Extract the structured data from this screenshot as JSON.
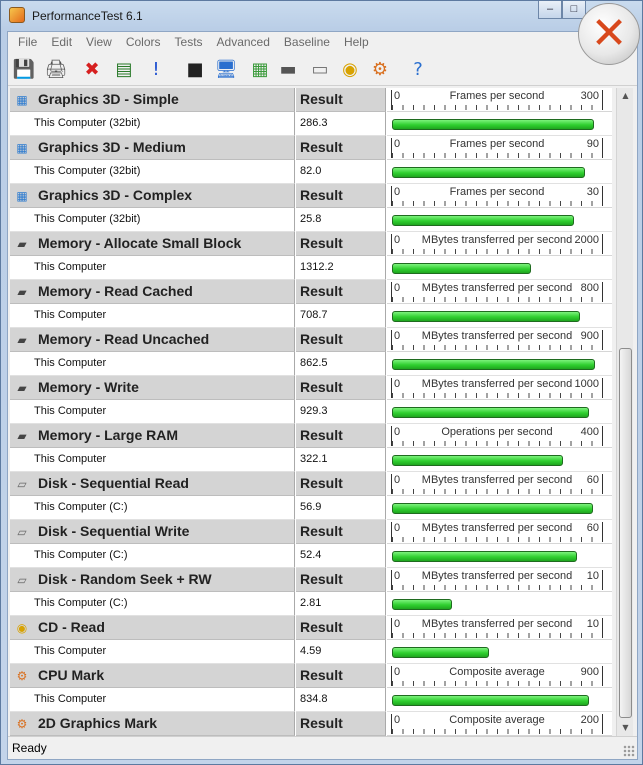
{
  "window": {
    "title": "PerformanceTest 6.1",
    "status": "Ready"
  },
  "menu": [
    "File",
    "Edit",
    "View",
    "Colors",
    "Tests",
    "Advanced",
    "Baseline",
    "Help"
  ],
  "toolbar": [
    {
      "name": "save-icon",
      "glyph": "💾"
    },
    {
      "name": "print-icon",
      "glyph": "🖨"
    },
    {
      "name": "delete-icon",
      "glyph": "✖"
    },
    {
      "name": "report-icon",
      "glyph": "▤"
    },
    {
      "name": "info-icon",
      "glyph": "!"
    },
    {
      "name": "stop-icon",
      "glyph": "■"
    },
    {
      "name": "monitor-icon",
      "glyph": "🖥"
    },
    {
      "name": "3d-cubes-icon",
      "glyph": "▦"
    },
    {
      "name": "memory-chip-icon",
      "glyph": "▬"
    },
    {
      "name": "disk-drive-icon",
      "glyph": "▭"
    },
    {
      "name": "cd-icon",
      "glyph": "◉"
    },
    {
      "name": "cpu-mark-icon",
      "glyph": "⚙"
    },
    {
      "name": "help-icon",
      "glyph": "?"
    }
  ],
  "result_label": "Result",
  "tests": [
    {
      "name": "Graphics 3D - Simple",
      "icon": "3d-cubes-icon",
      "computer": "This Computer (32bit)",
      "result": "286.3",
      "unit": "Frames per second",
      "min": "0",
      "max": "300",
      "value": 286.3,
      "scale_max": 300
    },
    {
      "name": "Graphics 3D - Medium",
      "icon": "3d-cubes-icon",
      "computer": "This Computer (32bit)",
      "result": "82.0",
      "unit": "Frames per second",
      "min": "0",
      "max": "90",
      "value": 82.0,
      "scale_max": 90
    },
    {
      "name": "Graphics 3D - Complex",
      "icon": "3d-cubes-icon",
      "computer": "This Computer (32bit)",
      "result": "25.8",
      "unit": "Frames per second",
      "min": "0",
      "max": "30",
      "value": 25.8,
      "scale_max": 30
    },
    {
      "name": "Memory - Allocate Small Block",
      "icon": "memory-chip-icon",
      "computer": "This Computer",
      "result": "1312.2",
      "unit": "MBytes transferred per second",
      "min": "0",
      "max": "2000",
      "value": 1312.2,
      "scale_max": 2000
    },
    {
      "name": "Memory - Read Cached",
      "icon": "memory-chip-icon",
      "computer": "This Computer",
      "result": "708.7",
      "unit": "MBytes transferred per second",
      "min": "0",
      "max": "800",
      "value": 708.7,
      "scale_max": 800
    },
    {
      "name": "Memory - Read Uncached",
      "icon": "memory-chip-icon",
      "computer": "This Computer",
      "result": "862.5",
      "unit": "MBytes transferred per second",
      "min": "0",
      "max": "900",
      "value": 862.5,
      "scale_max": 900
    },
    {
      "name": "Memory - Write",
      "icon": "memory-chip-icon",
      "computer": "This Computer",
      "result": "929.3",
      "unit": "MBytes transferred per second",
      "min": "0",
      "max": "1000",
      "value": 929.3,
      "scale_max": 1000
    },
    {
      "name": "Memory - Large RAM",
      "icon": "memory-chip-icon",
      "computer": "This Computer",
      "result": "322.1",
      "unit": "Operations per second",
      "min": "0",
      "max": "400",
      "value": 322.1,
      "scale_max": 400
    },
    {
      "name": "Disk - Sequential Read",
      "icon": "disk-drive-icon",
      "computer": "This Computer (C:)",
      "result": "56.9",
      "unit": "MBytes transferred per second",
      "min": "0",
      "max": "60",
      "value": 56.9,
      "scale_max": 60
    },
    {
      "name": "Disk - Sequential Write",
      "icon": "disk-drive-icon",
      "computer": "This Computer (C:)",
      "result": "52.4",
      "unit": "MBytes transferred per second",
      "min": "0",
      "max": "60",
      "value": 52.4,
      "scale_max": 60
    },
    {
      "name": "Disk - Random Seek + RW",
      "icon": "disk-drive-icon",
      "computer": "This Computer (C:)",
      "result": "2.81",
      "unit": "MBytes transferred per second",
      "min": "0",
      "max": "10",
      "value": 2.81,
      "scale_max": 10
    },
    {
      "name": "CD - Read",
      "icon": "cd-icon",
      "computer": "This Computer",
      "result": "4.59",
      "unit": "MBytes transferred per second",
      "min": "0",
      "max": "10",
      "value": 4.59,
      "scale_max": 10
    },
    {
      "name": "CPU Mark",
      "icon": "cpu-mark-icon",
      "computer": "This Computer",
      "result": "834.8",
      "unit": "Composite average",
      "min": "0",
      "max": "900",
      "value": 834.8,
      "scale_max": 900
    },
    {
      "name": "2D Graphics Mark",
      "icon": "cpu-mark-icon",
      "computer": "",
      "result": "",
      "unit": "Composite average",
      "min": "0",
      "max": "200",
      "value": null,
      "scale_max": 200
    }
  ],
  "colors": {
    "bar_fill": "#2fcf2f",
    "header_bg": "#d4d4d4",
    "close_accent": "#d8481c"
  }
}
